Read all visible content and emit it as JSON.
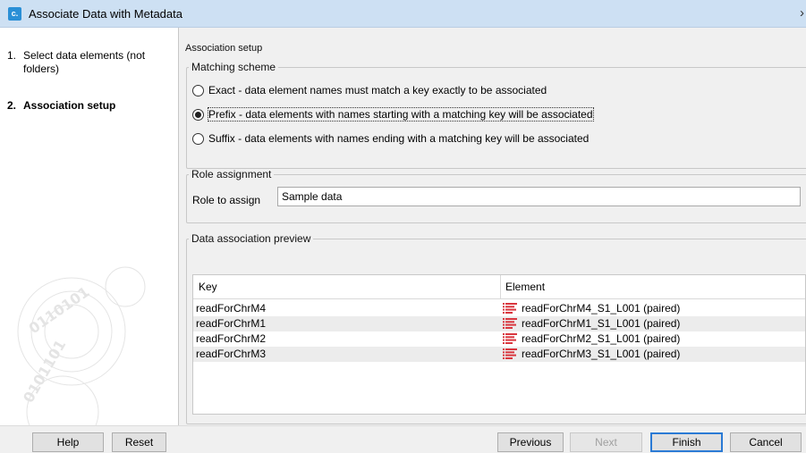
{
  "window": {
    "title": "Associate Data with Metadata",
    "app_icon_glyph": "c.",
    "close_glyph": "›"
  },
  "sidebar": {
    "steps": [
      {
        "number": "1.",
        "label": "Select data elements (not folders)",
        "active": false
      },
      {
        "number": "2.",
        "label": "Association setup",
        "active": true
      }
    ]
  },
  "main": {
    "caption": "Association setup",
    "matching_scheme": {
      "legend": "Matching scheme",
      "options": [
        {
          "label": "Exact - data element names must match a key exactly to be associated",
          "selected": false
        },
        {
          "label": "Prefix - data elements with names starting with a matching key will be associated",
          "selected": true
        },
        {
          "label": "Suffix - data elements with names ending with a matching key will be associated",
          "selected": false
        }
      ]
    },
    "role_assignment": {
      "legend": "Role assignment",
      "label": "Role to assign",
      "value": "Sample data"
    },
    "preview": {
      "legend": "Data association preview",
      "columns": [
        "Key",
        "Element"
      ],
      "rows": [
        {
          "key": "readForChrM4",
          "element": "readForChrM4_S1_L001 (paired)"
        },
        {
          "key": "readForChrM1",
          "element": "readForChrM1_S1_L001 (paired)"
        },
        {
          "key": "readForChrM2",
          "element": "readForChrM2_S1_L001 (paired)"
        },
        {
          "key": "readForChrM3",
          "element": "readForChrM3_S1_L001 (paired)"
        }
      ],
      "row_icon": "sequence-list-icon"
    }
  },
  "footer": {
    "help": "Help",
    "reset": "Reset",
    "previous": "Previous",
    "next": "Next",
    "finish": "Finish",
    "cancel": "Cancel"
  },
  "colors": {
    "titlebar": "#cde0f3",
    "accent": "#2a7ad5",
    "icon_red": "#d9363e"
  }
}
